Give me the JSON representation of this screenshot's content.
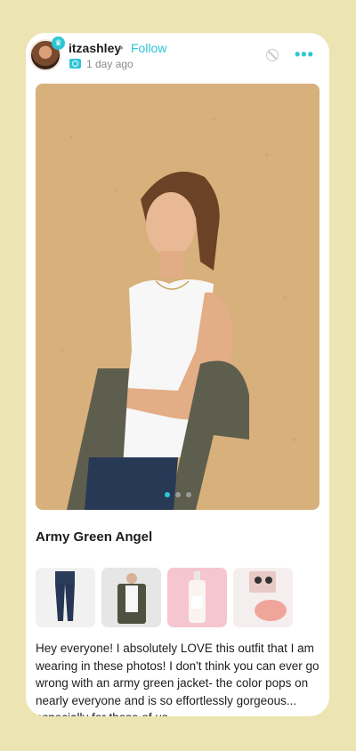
{
  "post": {
    "username": "itzashley",
    "separator": "•",
    "follow_label": "Follow",
    "time_ago": "1 day ago",
    "more_label": "•••"
  },
  "colors": {
    "accent": "#2cc6d6",
    "background": "#ede4b3"
  },
  "carousel": {
    "current_index": 1,
    "total": 3
  },
  "outfit": {
    "title": "Army Green Angel",
    "items": [
      "jeans",
      "army-green-jacket",
      "spray-bottle",
      "blush-compact"
    ]
  },
  "description": "Hey everyone! I absolutely LOVE this outfit that I am wearing in these photos! I don't think you can ever go wrong with an army green jacket- the color pops on nearly everyone and is so effortlessly gorgeous... especially for those of us"
}
